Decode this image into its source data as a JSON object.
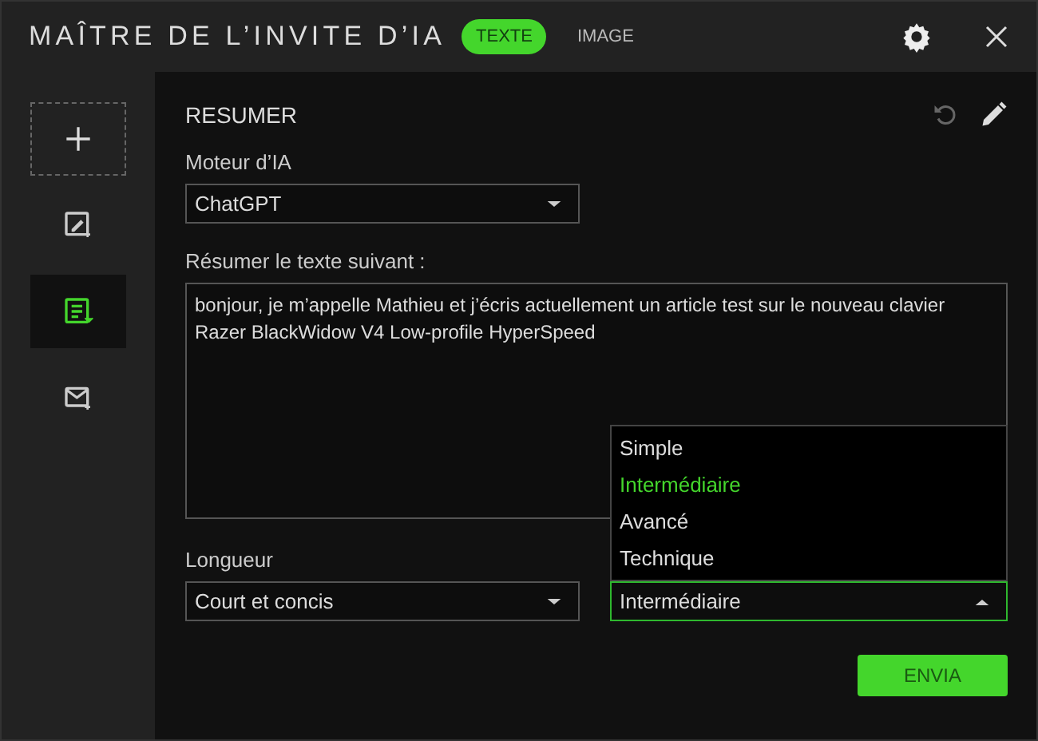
{
  "window": {
    "title": "MAÎTRE DE L’INVITE D’IA"
  },
  "tabs": [
    {
      "label": "TEXTE",
      "selected": true
    },
    {
      "label": "IMAGE",
      "selected": false
    }
  ],
  "sidebar": {
    "items": [
      {
        "kind": "add",
        "selected": false
      },
      {
        "kind": "image-edit",
        "selected": false
      },
      {
        "kind": "summary",
        "selected": true
      },
      {
        "kind": "mail",
        "selected": false
      }
    ]
  },
  "panel": {
    "title": "RESUMER"
  },
  "engine": {
    "label": "Moteur d’IA",
    "value": "ChatGPT",
    "expanded": false
  },
  "text": {
    "label": "Résumer le texte suivant :",
    "value": "bonjour, je m’appelle Mathieu et j’écris actuellement un article test sur le nouveau clavier Razer BlackWidow V4 Low-profile HyperSpeed"
  },
  "length": {
    "label": "Longueur",
    "value": "Court et concis",
    "expanded": false
  },
  "level": {
    "value": "Intermédiaire",
    "expanded": true,
    "options": [
      {
        "label": "Simple",
        "selected": false
      },
      {
        "label": "Intermédiaire",
        "selected": true
      },
      {
        "label": "Avancé",
        "selected": false
      },
      {
        "label": "Technique",
        "selected": false
      }
    ]
  },
  "submit": {
    "label": "ENVIA"
  }
}
